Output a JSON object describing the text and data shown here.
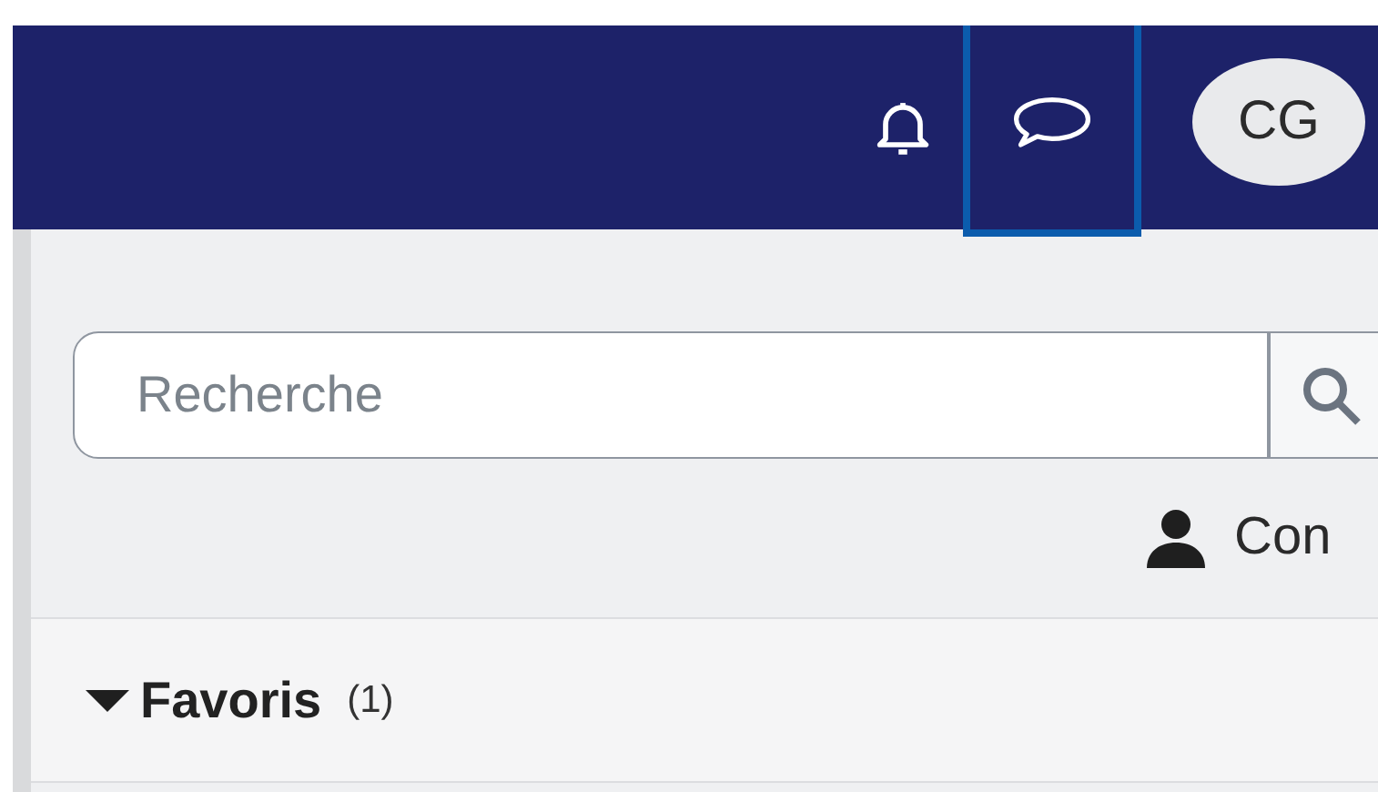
{
  "top_bar": {
    "icons": [
      {
        "kind": "bell",
        "selected": false
      },
      {
        "kind": "chat",
        "selected": true
      }
    ],
    "avatar": "CG"
  },
  "search": {
    "placeholder": "Recherche"
  },
  "contact_link": "Con",
  "favorites": {
    "label": "Favoris",
    "count": "(1)",
    "expanded": true
  }
}
